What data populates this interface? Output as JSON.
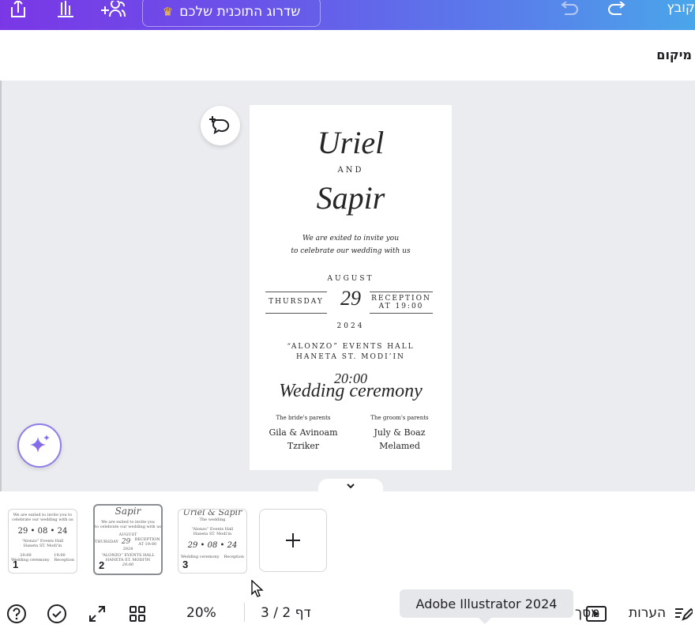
{
  "topbar": {
    "upgrade_label": "שדרוג התוכנית שלכם",
    "file_menu_label": "קובץ",
    "colors": {
      "gradient_start": "#7a37e6",
      "gradient_end": "#4aa6ea",
      "crown": "#f4c247"
    },
    "icons": [
      "share-icon",
      "insights-icon",
      "add-people-icon",
      "undo-icon",
      "redo-icon",
      "crown-icon"
    ]
  },
  "subbar": {
    "position_label": "מיקום"
  },
  "invitation": {
    "name1": "Uriel",
    "and": "AND",
    "name2": "Sapir",
    "invite_line1": "We are exited to invite you",
    "invite_line2": "to celebrate our wedding with us",
    "month": "AUGUST",
    "weekday": "THURSDAY",
    "day": "29",
    "reception_line1": "RECEPTION",
    "reception_line2": "AT 19:00",
    "year": "2024",
    "venue_line1": "“ALONZO” EVENTS HALL",
    "venue_line2": "HANETA ST. MODI’IN",
    "ceremony_time": "20:00",
    "ceremony_label": "Wedding ceremony",
    "bride_parents_label": "The bride's parents",
    "bride_parents_line1": "Gila & Avinoam",
    "bride_parents_line2": "Tzriker",
    "groom_parents_label": "The groom's parents",
    "groom_parents_line1": "July & Boaz",
    "groom_parents_line2": "Melamed"
  },
  "pages": [
    {
      "number": "1",
      "selected": false,
      "line1": "We are exited to invite you to",
      "line2": "celebrate our wedding with us",
      "date": "29 • 08 • 24",
      "venue1": "“Alonzo” Events Hall",
      "venue2": "Haneta ST. Modi'in",
      "time1": "20:00",
      "time2": "19:00",
      "label1": "Wedding ceremony",
      "label2": "Reception"
    },
    {
      "number": "2",
      "selected": true,
      "title": "Sapir",
      "line1": "We are exited to invite you",
      "line2": "to celebrate our wedding with us",
      "month": "AUGUST",
      "day": "29",
      "weekday": "THURSDAY",
      "reception": "RECEPTION AT 19:00",
      "year": "2024",
      "venue1": "“ALONZO” EVENTS HALL",
      "venue2": "HANETA ST. MODI'IN",
      "time": "20:00"
    },
    {
      "number": "3",
      "selected": false,
      "title": "Uriel & Sapir",
      "subtitle": "The wedding",
      "venue1": "“Alonzo” Events Hall",
      "venue2": "Haneta ST. Modi'in",
      "date": "29 • 08 • 24",
      "label1": "Wedding ceremony",
      "label2": "Reception"
    }
  ],
  "bottombar": {
    "zoom": "20%",
    "page_count": "דף 2 / 3",
    "present_label": "מסך מלא",
    "notes_label": "הערות",
    "icons": [
      "help-icon",
      "check-icon",
      "fullscreen-icon",
      "grid-view-icon",
      "present-icon",
      "notes-icon"
    ]
  },
  "tooltip": {
    "text": "Adobe Illustrator 2024"
  }
}
